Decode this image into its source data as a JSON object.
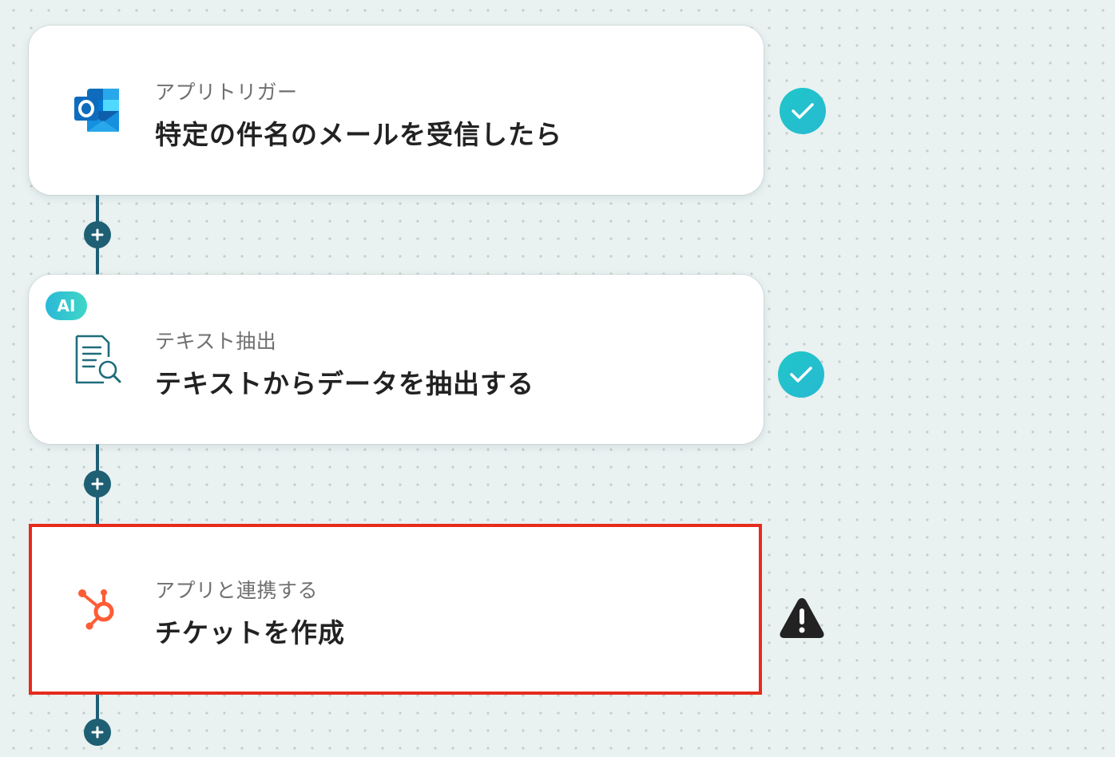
{
  "flow": {
    "steps": [
      {
        "type_label": "アプリトリガー",
        "title": "特定の件名のメールを受信したら",
        "icon": "outlook-icon",
        "status": "complete"
      },
      {
        "badge": "AI",
        "type_label": "テキスト抽出",
        "title": "テキストからデータを抽出する",
        "icon": "document-search-icon",
        "status": "complete"
      },
      {
        "type_label": "アプリと連携する",
        "title": "チケットを作成",
        "icon": "hubspot-icon",
        "status": "warning",
        "selected": true
      }
    ],
    "add_button_icon": "plus-icon"
  },
  "colors": {
    "background": "#e9f1f1",
    "connector": "#1e5f74",
    "success": "#1fc7c9",
    "warning": "#222222",
    "selected_border": "#e62b1c",
    "hubspot": "#ff5c35",
    "outlook": "#0f6cbd"
  }
}
